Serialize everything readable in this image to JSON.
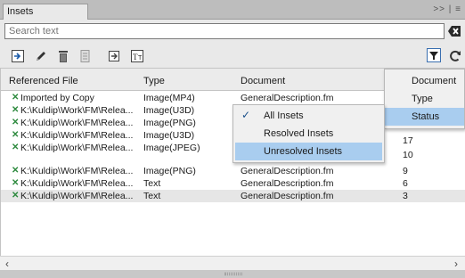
{
  "panel": {
    "tab_label": "Insets",
    "tab_controls": ">> | ≡"
  },
  "search": {
    "value": "",
    "placeholder": "Search text"
  },
  "toolbar": {
    "icons": [
      "go-to-source-icon",
      "edit-icon",
      "delete-icon",
      "copy-icon",
      "embed-icon",
      "text-inset-icon",
      "filter-icon",
      "refresh-icon"
    ]
  },
  "table": {
    "headers": [
      "Referenced File",
      "Type",
      "Document",
      "Status"
    ],
    "rows": [
      {
        "file": "Imported by Copy",
        "type": "Image(MP4)",
        "document": "GeneralDescription.fm",
        "status": ""
      },
      {
        "file": "K:\\Kuldip\\Work\\FM\\Relea...",
        "type": "Image(U3D)",
        "document": "",
        "status": ""
      },
      {
        "file": "K:\\Kuldip\\Work\\FM\\Relea...",
        "type": "Image(PNG)",
        "document": "",
        "status": "9"
      },
      {
        "file": "K:\\Kuldip\\Work\\FM\\Relea...",
        "type": "Image(U3D)",
        "document": "",
        "status": "17"
      },
      {
        "file": "K:\\Kuldip\\Work\\FM\\Relea...",
        "type": "Image(JPEG)",
        "document": "",
        "status": "10"
      },
      {
        "file": "K:\\Kuldip\\Work\\FM\\Relea...",
        "type": "Image(PNG)",
        "document": "GeneralDescription.fm",
        "status": "9"
      },
      {
        "file": "K:\\Kuldip\\Work\\FM\\Relea...",
        "type": "Text",
        "document": "GeneralDescription.fm",
        "status": "6"
      },
      {
        "file": "K:\\Kuldip\\Work\\FM\\Relea...",
        "type": "Text",
        "document": "GeneralDescription.fm",
        "status": "3"
      }
    ]
  },
  "column_menu": {
    "items": [
      "Document",
      "Type",
      "Status"
    ],
    "highlighted": "Status"
  },
  "status_submenu": {
    "items": [
      "All Insets",
      "Resolved Insets",
      "Unresolved Insets"
    ],
    "checked": "All Insets",
    "highlighted": "Unresolved Insets"
  },
  "colors": {
    "highlight": "#a9cdef",
    "link_icon": "#2d8a3e",
    "check": "#1a4f8a"
  }
}
